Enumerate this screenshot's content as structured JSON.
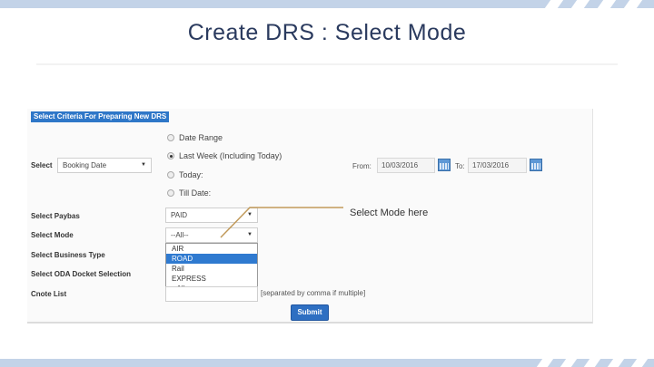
{
  "slide": {
    "title": "Create DRS : Select Mode"
  },
  "form": {
    "header": "Select Criteria For Preparing New DRS",
    "select_label": "Select",
    "select_value": "Booking Date",
    "date_options": [
      {
        "label": "Date Range",
        "checked": false
      },
      {
        "label": "Last Week (Including Today)",
        "checked": true
      },
      {
        "label": "Today:",
        "checked": false
      },
      {
        "label": "Till Date:",
        "checked": false
      }
    ],
    "from_label": "From:",
    "from_value": "10/03/2016",
    "to_label": "To:",
    "to_value": "17/03/2016",
    "paybas_label": "Select Paybas",
    "paybas_value": "PAID",
    "mode_label": "Select Mode",
    "mode_value": "--All--",
    "mode_options": [
      "AIR",
      "ROAD",
      "Rail",
      "EXPRESS",
      "--All--"
    ],
    "mode_highlighted": "ROAD",
    "business_type_label": "Select Business Type",
    "oda_label": "Select ODA Docket Selection",
    "quote_label": "Cnote List",
    "quote_hint": "[separated by comma if multiple]",
    "submit_label": "Submit"
  },
  "callout": {
    "text": "Select Mode here",
    "color": "#c19a5b"
  },
  "colors": {
    "stripe": "#c3d3e8",
    "header_bg": "#2e77c8",
    "highlight": "#2f7ad0",
    "button": "#2e6fc2"
  }
}
